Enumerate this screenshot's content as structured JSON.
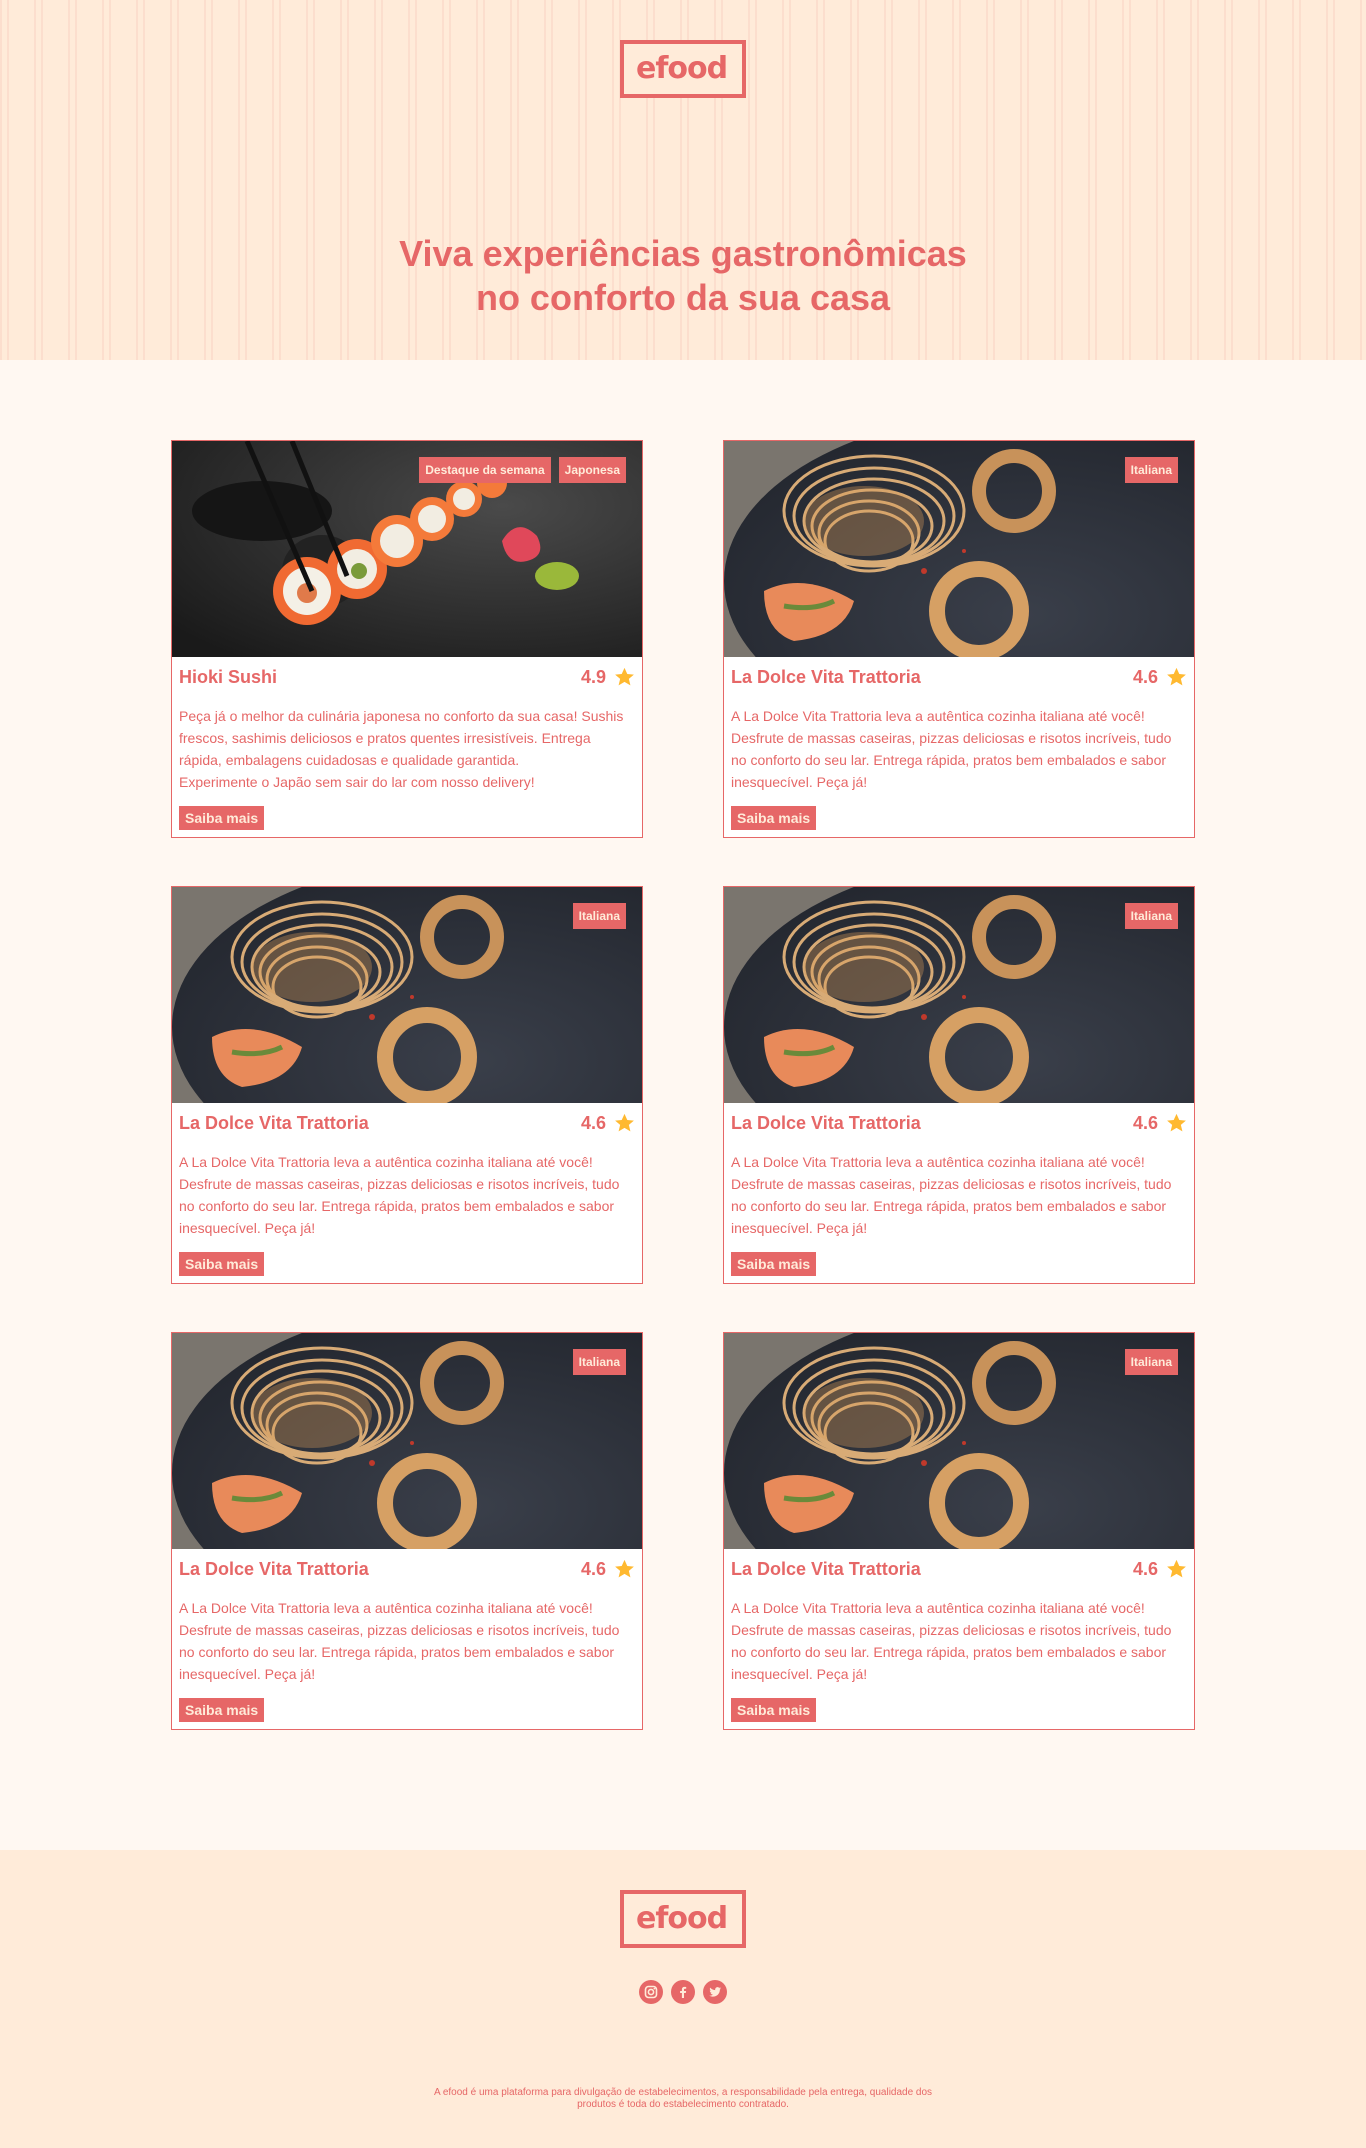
{
  "brand": {
    "logo_text": "efood"
  },
  "hero": {
    "title_line1": "Viva experiências gastronômicas",
    "title_line2": "no conforto da sua casa"
  },
  "restaurants": [
    {
      "tags": [
        "Destaque da semana",
        "Japonesa"
      ],
      "image": "sushi",
      "name": "Hioki Sushi",
      "rating": "4.9",
      "description_lines": [
        "Peça já o melhor da culinária japonesa no conforto da sua casa! Sushis frescos, sashimis deliciosos e pratos quentes irresistíveis. Entrega rápida, embalagens cuidadosas e qualidade garantida.",
        "Experimente o Japão sem sair do lar com nosso delivery!"
      ],
      "button": "Saiba mais"
    },
    {
      "tags": [
        "Italiana"
      ],
      "image": "pasta",
      "name": "La Dolce Vita Trattoria",
      "rating": "4.6",
      "description_lines": [
        "A La Dolce Vita Trattoria leva a autêntica cozinha italiana até você! Desfrute de massas caseiras, pizzas deliciosas e risotos incríveis, tudo no conforto do seu lar. Entrega rápida, pratos bem embalados e sabor inesquecível. Peça já!"
      ],
      "button": "Saiba mais"
    },
    {
      "tags": [
        "Italiana"
      ],
      "image": "pasta",
      "name": "La Dolce Vita Trattoria",
      "rating": "4.6",
      "description_lines": [
        "A La Dolce Vita Trattoria leva a autêntica cozinha italiana até você! Desfrute de massas caseiras, pizzas deliciosas e risotos incríveis, tudo no conforto do seu lar. Entrega rápida, pratos bem embalados e sabor inesquecível. Peça já!"
      ],
      "button": "Saiba mais"
    },
    {
      "tags": [
        "Italiana"
      ],
      "image": "pasta",
      "name": "La Dolce Vita Trattoria",
      "rating": "4.6",
      "description_lines": [
        "A La Dolce Vita Trattoria leva a autêntica cozinha italiana até você! Desfrute de massas caseiras, pizzas deliciosas e risotos incríveis, tudo no conforto do seu lar. Entrega rápida, pratos bem embalados e sabor inesquecível. Peça já!"
      ],
      "button": "Saiba mais"
    },
    {
      "tags": [
        "Italiana"
      ],
      "image": "pasta",
      "name": "La Dolce Vita Trattoria",
      "rating": "4.6",
      "description_lines": [
        "A La Dolce Vita Trattoria leva a autêntica cozinha italiana até você! Desfrute de massas caseiras, pizzas deliciosas e risotos incríveis, tudo no conforto do seu lar. Entrega rápida, pratos bem embalados e sabor inesquecível. Peça já!"
      ],
      "button": "Saiba mais"
    },
    {
      "tags": [
        "Italiana"
      ],
      "image": "pasta",
      "name": "La Dolce Vita Trattoria",
      "rating": "4.6",
      "description_lines": [
        "A La Dolce Vita Trattoria leva a autêntica cozinha italiana até você! Desfrute de massas caseiras, pizzas deliciosas e risotos incríveis, tudo no conforto do seu lar. Entrega rápida, pratos bem embalados e sabor inesquecível. Peça já!"
      ],
      "button": "Saiba mais"
    }
  ],
  "footer": {
    "socials": [
      "instagram-icon",
      "facebook-icon",
      "twitter-icon"
    ],
    "disclaimer": "A efood é uma plataforma para divulgação de estabelecimentos, a responsabilidade pela entrega, qualidade dos produtos é toda do estabelecimento contratado."
  },
  "colors": {
    "primary": "#E66767",
    "light": "#FFEBD9",
    "background": "#FFF8F2",
    "star": "#FFB930"
  }
}
